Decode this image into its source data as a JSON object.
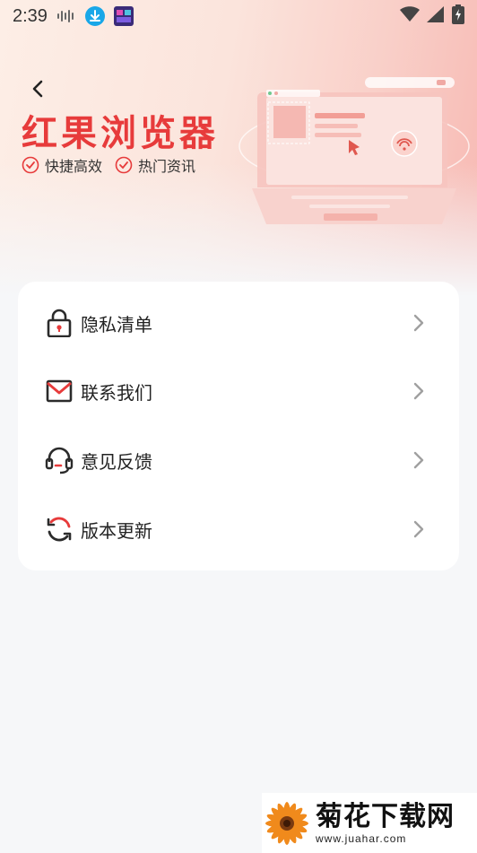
{
  "status_bar": {
    "time": "2:39",
    "icons": [
      "audio-wave-icon",
      "download-icon",
      "app-thumbnail-icon",
      "wifi-icon",
      "signal-icon",
      "battery-charging-icon"
    ]
  },
  "header": {
    "back_icon": "chevron-left-icon",
    "brand": "红果浏览器",
    "tags": [
      {
        "icon": "check-circle-icon",
        "label": "快捷高效"
      },
      {
        "icon": "check-circle-icon",
        "label": "热门资讯"
      }
    ],
    "accent_color": "#e73b3b"
  },
  "menu": {
    "items": [
      {
        "icon": "lock-icon",
        "label": "隐私清单"
      },
      {
        "icon": "mail-icon",
        "label": "联系我们"
      },
      {
        "icon": "headset-icon",
        "label": "意见反馈"
      },
      {
        "icon": "refresh-icon",
        "label": "版本更新"
      }
    ]
  },
  "watermark": {
    "title": "菊花下载网",
    "url": "www.juahar.com"
  }
}
